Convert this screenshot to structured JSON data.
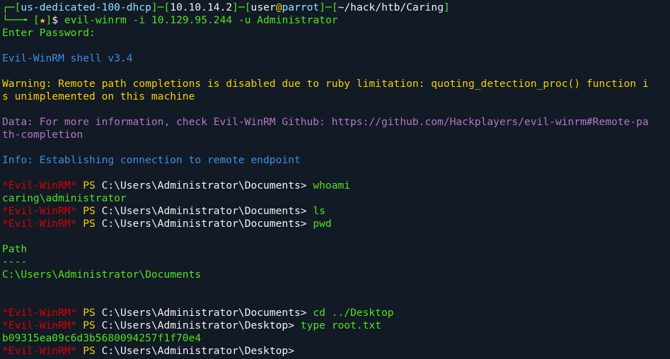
{
  "prompt": {
    "tree_top": "┌─",
    "tree_bottom": "└──╼ ",
    "host": "us-dedicated-100-dhcp",
    "ip": "10.10.14.2",
    "user": "user",
    "at": "@",
    "machine": "parrot",
    "cwd": "~/hack/htb/Caring",
    "star": "★",
    "dollar": "$",
    "command": "evil-winrm -i 10.129.95.244 -u Administrator"
  },
  "lines": {
    "enter_password": "Enter Password:",
    "shell_version": "Evil-WinRM shell v3.4",
    "warning_1": "Warning: Remote path completions is disabled due to ruby limitation: quoting_detection_proc() function i",
    "warning_2": "s unimplemented on this machine",
    "data_1": "Data: For more information, check Evil-WinRM Github: https://github.com/Hackplayers/evil-winrm#Remote-pa",
    "data_2": "th-completion",
    "info": "Info: Establishing connection to remote endpoint"
  },
  "session": {
    "tag": "*Evil-WinRM*",
    "ps": "PS",
    "entries": [
      {
        "path": "C:\\Users\\Administrator\\Documents>",
        "command": "whoami"
      },
      {
        "path": "C:\\Users\\Administrator\\Documents>",
        "command": "ls"
      },
      {
        "path": "C:\\Users\\Administrator\\Documents>",
        "command": "pwd"
      },
      {
        "path": "C:\\Users\\Administrator\\Documents>",
        "command": "cd ../Desktop"
      },
      {
        "path": "C:\\Users\\Administrator\\Desktop>",
        "command": "type root.txt"
      },
      {
        "path": "C:\\Users\\Administrator\\Desktop>",
        "command": ""
      }
    ],
    "whoami_output": "caring\\administrator",
    "pwd_header": "Path",
    "pwd_underline": "----",
    "pwd_value": "C:\\Users\\Administrator\\Documents",
    "root_flag": "b09315ea09c6d3b5680094257f1f70e4"
  },
  "colors": {
    "background": "#121a26",
    "green": "#52e21c",
    "yellow": "#f5d000",
    "blue": "#3d8fe3",
    "purple": "#b276c6",
    "red": "#d90000"
  }
}
